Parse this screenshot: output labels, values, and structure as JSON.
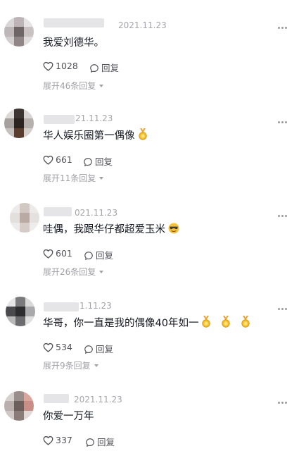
{
  "comments": [
    {
      "date": "2021.11.23",
      "text": "我爱刘德华。",
      "likes": "1028",
      "reply_label": "回复",
      "expand_label": "展开46条回复",
      "emoji": []
    },
    {
      "date": "21.11.23",
      "text": "华人娱乐圈第一偶像",
      "likes": "661",
      "reply_label": "回复",
      "expand_label": "展开11条回复",
      "emoji": [
        "medal-emoji"
      ]
    },
    {
      "date": "021.11.23",
      "text": "哇偶，我跟华仔都超爱玉米",
      "likes": "601",
      "reply_label": "回复",
      "expand_label": "展开26条回复",
      "emoji": [
        "cool-face-emoji"
      ]
    },
    {
      "date": "1.11.23",
      "text": "华哥，你一直是我的偶像40年如一",
      "likes": "534",
      "reply_label": "回复",
      "expand_label": "展开9条回复",
      "emoji": [
        "medal-emoji",
        "medal-emoji",
        "medal-emoji"
      ]
    },
    {
      "date": "2021.11.23",
      "text": "你爱一万年",
      "likes": "337",
      "reply_label": "回复",
      "expand_label": "",
      "emoji": []
    }
  ],
  "icons": {
    "like": "heart-outline-icon",
    "reply": "speech-bubble-icon",
    "more": "more-dots-icon",
    "expand": "caret-down-icon"
  },
  "colors": {
    "text": "#161823",
    "meta": "#a4a4aa",
    "action": "#52525a",
    "medal_ribbon": "#e8a33d",
    "medal_gold": "#f5c026",
    "emoji_face": "#f7c23c"
  }
}
